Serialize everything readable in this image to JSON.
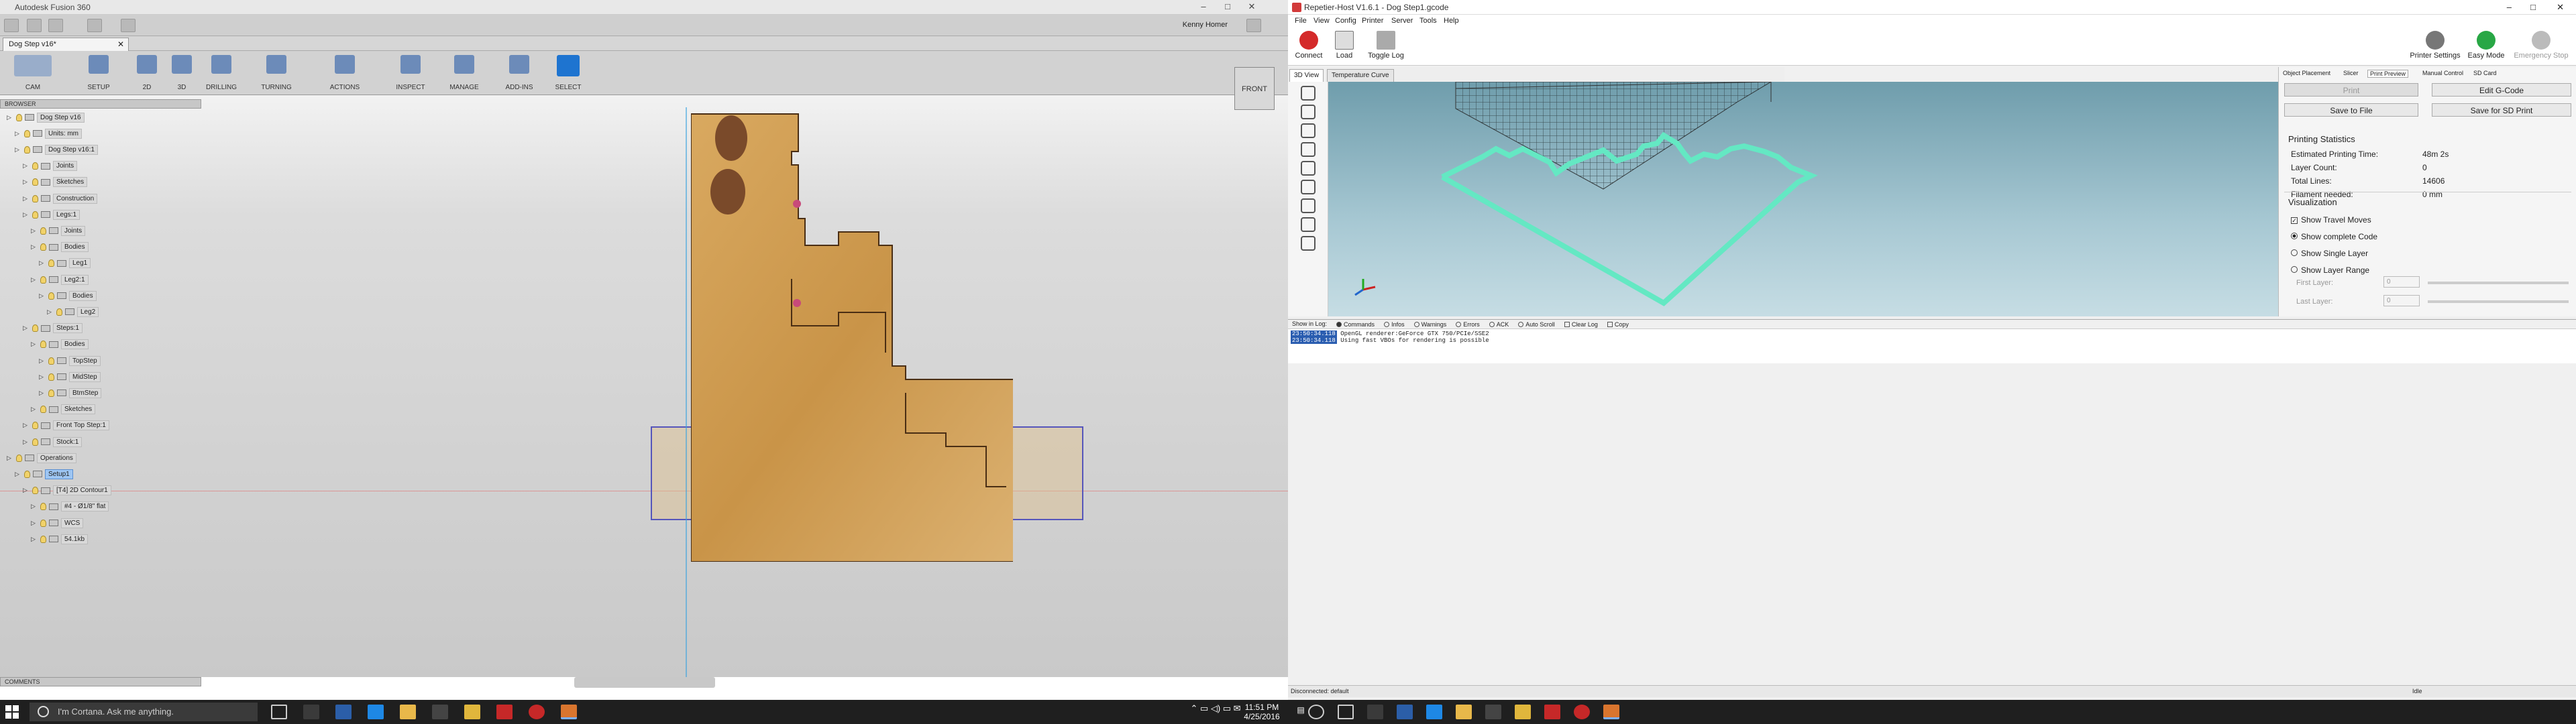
{
  "fusion": {
    "window_title": "Autodesk Fusion 360",
    "user_name": "Kenny Homer",
    "doc_tab": "Dog Step v16*",
    "ribbon": [
      {
        "name": "cam",
        "label": "CAM"
      },
      {
        "name": "setup",
        "label": "SETUP"
      },
      {
        "name": "2d",
        "label": "2D"
      },
      {
        "name": "3d",
        "label": "3D"
      },
      {
        "name": "drilling",
        "label": "DRILLING"
      },
      {
        "name": "turning",
        "label": "TURNING"
      },
      {
        "name": "actions",
        "label": "ACTIONS"
      },
      {
        "name": "inspect",
        "label": "INSPECT"
      },
      {
        "name": "manage",
        "label": "MANAGE"
      },
      {
        "name": "addins",
        "label": "ADD-INS"
      },
      {
        "name": "select",
        "label": "SELECT"
      }
    ],
    "browser_title": "BROWSER",
    "comments_title": "COMMENTS",
    "viewcube_label": "FRONT",
    "tree": [
      {
        "label": "Dog Step v16",
        "depth": 0
      },
      {
        "label": "Units: mm",
        "depth": 1
      },
      {
        "label": "Dog Step v16:1",
        "depth": 1
      },
      {
        "label": "Joints",
        "depth": 2
      },
      {
        "label": "Sketches",
        "depth": 2
      },
      {
        "label": "Construction",
        "depth": 2
      },
      {
        "label": "Legs:1",
        "depth": 2
      },
      {
        "label": "Joints",
        "depth": 3
      },
      {
        "label": "Bodies",
        "depth": 3
      },
      {
        "label": "Leg1",
        "depth": 4
      },
      {
        "label": "Leg2:1",
        "depth": 3
      },
      {
        "label": "Bodies",
        "depth": 4
      },
      {
        "label": "Leg2",
        "depth": 5
      },
      {
        "label": "Steps:1",
        "depth": 2
      },
      {
        "label": "Bodies",
        "depth": 3
      },
      {
        "label": "TopStep",
        "depth": 4
      },
      {
        "label": "MidStep",
        "depth": 4
      },
      {
        "label": "BtmStep",
        "depth": 4
      },
      {
        "label": "Sketches",
        "depth": 3
      },
      {
        "label": "Front Top Step:1",
        "depth": 2
      },
      {
        "label": "Stock:1",
        "depth": 2
      },
      {
        "label": "Operations",
        "depth": 0
      },
      {
        "label": "Setup1",
        "depth": 1,
        "selected": true
      },
      {
        "label": "[T4] 2D Contour1",
        "depth": 2
      },
      {
        "label": "#4 - Ø1/8\" flat",
        "depth": 3
      },
      {
        "label": "WCS",
        "depth": 3
      },
      {
        "label": "54.1kb",
        "depth": 3
      }
    ]
  },
  "repetier": {
    "window_title": "Repetier-Host V1.6.1 - Dog Step1.gcode",
    "menu": [
      "File",
      "View",
      "Config",
      "Printer",
      "Server",
      "Tools",
      "Help"
    ],
    "toolbar": {
      "connect": "Connect",
      "load": "Load",
      "toggle_log": "Toggle Log",
      "printer_settings": "Printer Settings",
      "easy_mode": "Easy Mode",
      "emergency_stop": "Emergency Stop"
    },
    "view_tabs": [
      "3D View",
      "Temperature Curve"
    ],
    "right_tabs": [
      "Object Placement",
      "Slicer",
      "Print Preview",
      "Manual Control",
      "SD Card"
    ],
    "active_right_tab": "Print Preview",
    "buttons": {
      "print": "Print",
      "edit_gcode": "Edit G-Code",
      "save_file": "Save to File",
      "save_sd": "Save for SD Print"
    },
    "stats_title": "Printing Statistics",
    "stats": [
      {
        "k": "Estimated Printing Time:",
        "v": "48m 2s"
      },
      {
        "k": "Layer Count:",
        "v": "0"
      },
      {
        "k": "Total Lines:",
        "v": "14606"
      },
      {
        "k": "Filament needed:",
        "v": "0 mm"
      }
    ],
    "viz_title": "Visualization",
    "viz_options": [
      "Show Travel Moves",
      "Show complete Code",
      "Show Single Layer",
      "Show Layer Range"
    ],
    "first_layer_label": "First Layer:",
    "last_layer_label": "Last Layer:",
    "first_layer_value": "0",
    "last_layer_value": "0",
    "log_filters": [
      "Show in Log:",
      "Commands",
      "Infos",
      "Warnings",
      "Errors",
      "ACK",
      "Auto Scroll",
      "Clear Log",
      "Copy"
    ],
    "log_lines": [
      {
        "time": "23:50:34.118",
        "text": "OpenGL renderer:GeForce GTX 750/PCIe/SSE2"
      },
      {
        "time": "23:50:34.118",
        "text": "Using fast VBOs for rendering is possible"
      }
    ],
    "status_left": "Disconnected: default",
    "status_right": "Idle"
  },
  "taskbar": {
    "search_placeholder": "I'm Cortana. Ask me anything.",
    "time": "11:51 PM",
    "date": "4/25/2016"
  },
  "colors": {
    "gcode_path": "#64e8c3",
    "fusion_select": "#1e74d0",
    "repetier_bg": "#89b6c4"
  }
}
